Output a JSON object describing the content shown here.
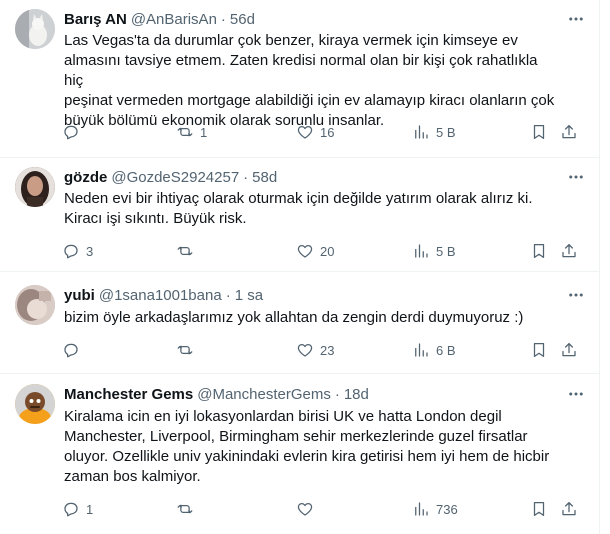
{
  "tweets": [
    {
      "name": "Barış AN",
      "handle": "@AnBarisAn",
      "sep": "·",
      "time": "56d",
      "text": "Las Vegas'ta da durumlar çok benzer, kiraya vermek için kimseye ev\nalmasını tavsiye etmem. Zaten kredisi normal olan bir kişi çok rahatlıkla hiç\npeşinat vermeden mortgage alabildiği için ev alamayıp kiracı olanların çok\nbüyük bölümü ekonomik olarak sorunlu insanlar.",
      "replies": "",
      "retweets": "1",
      "likes": "16",
      "views": "5 B",
      "avatar_color": "#cfd2d6"
    },
    {
      "name": "gözde",
      "handle": "@GozdeS2924257",
      "sep": "·",
      "time": "58d",
      "text": "Neden evi bir ihtiyaç olarak oturmak için  değilde yatırım olarak alırız ki.\nKiracı işi sıkıntı. Büyük risk.",
      "replies": "3",
      "retweets": "",
      "likes": "20",
      "views": "5 B",
      "avatar_color": "#5a4a45"
    },
    {
      "name": "yubi",
      "handle": "@1sana1001bana",
      "sep": "·",
      "time": "1 sa",
      "text": "bizim öyle arkadaşlarımız yok allahtan da zengin derdi duymuyoruz :)",
      "replies": "",
      "retweets": "",
      "likes": "23",
      "views": "6 B",
      "avatar_color": "#b8a59f"
    },
    {
      "name": "Manchester Gems",
      "handle": "@ManchesterGems",
      "sep": "·",
      "time": "18d",
      "text": "Kiralama icin en iyi lokasyonlardan birisi UK ve hatta London degil\nManchester, Liverpool, Birmingham sehir merkezlerinde guzel firsatlar\noluyor. Ozellikle univ yakinindaki evlerin kira getirisi hem iyi hem de hicbir\nzaman bos kalmiyor.",
      "replies": "1",
      "retweets": "",
      "likes": "",
      "views": "736",
      "avatar_color": "#f5a01a"
    }
  ],
  "icons": {
    "reply": "reply-icon",
    "retweet": "retweet-icon",
    "like": "heart-icon",
    "views": "analytics-icon",
    "bookmark": "bookmark-icon",
    "share": "share-icon",
    "more": "more-icon"
  },
  "colors": {
    "text": "#0f1419",
    "secondary": "#536471",
    "border": "#eff3f4"
  }
}
